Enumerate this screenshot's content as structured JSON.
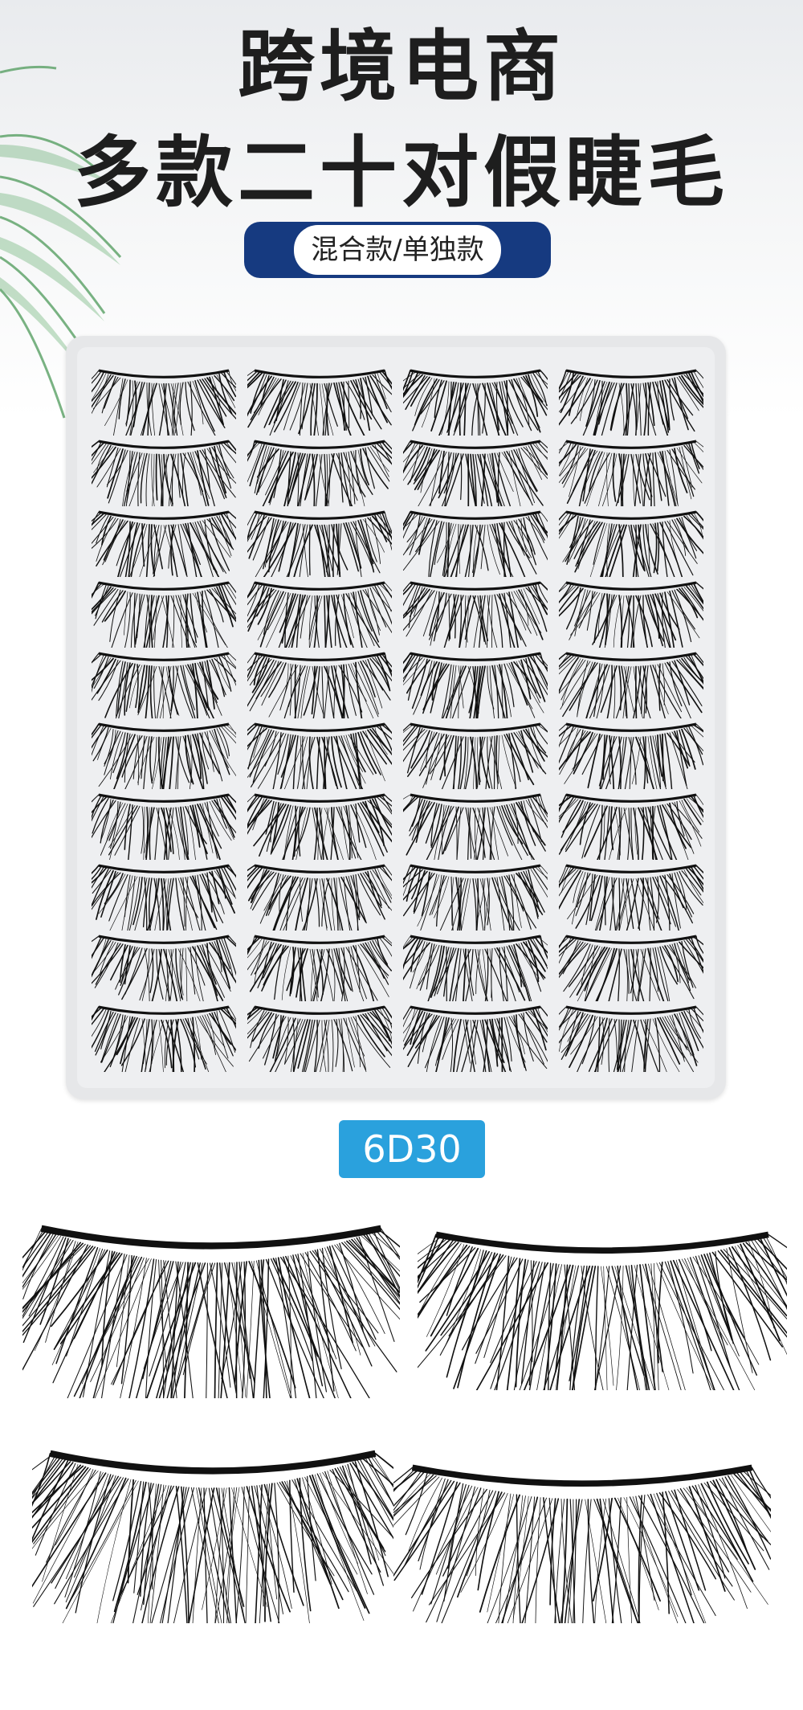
{
  "header": {
    "title_line1": "跨境电商",
    "title_line2": "多款二十对假睫毛",
    "subtitle": "混合款/单独款"
  },
  "product": {
    "model_code": "6D30",
    "tray_rows": 10,
    "tray_columns": 4,
    "pair_count": 20
  },
  "colors": {
    "title": "#1e1e1e",
    "subtitle_pill": "#163a80",
    "badge": "#2aa1dd",
    "tray": "#e6e7e9",
    "lash": "#111111",
    "leaf": "#4e9a5a"
  },
  "icons": {
    "decoration": "palm-leaf-icon",
    "product_image": "eyelash-icon"
  }
}
